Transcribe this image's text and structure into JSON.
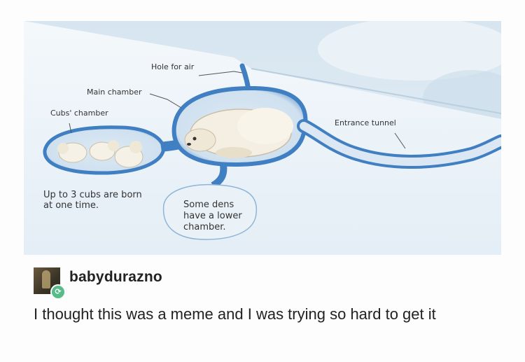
{
  "illustration": {
    "labels": {
      "hole_for_air": "Hole for air",
      "main_chamber": "Main chamber",
      "cubs_chamber": "Cubs' chamber",
      "entrance_tunnel": "Entrance tunnel",
      "cubs_note": "Up to 3 cubs are born at one time.",
      "lower_chamber_note_1": "Some dens",
      "lower_chamber_note_2": "have a lower",
      "lower_chamber_note_3": "chamber."
    },
    "colors": {
      "snow": "#eef4f9",
      "den_outline": "#3f7fc2",
      "sky": "#dfeaf2"
    }
  },
  "post": {
    "username": "babydurazno",
    "avatar_icon": "user-avatar",
    "reblog_icon": "reblog-icon",
    "text": "I thought this was a meme and I was trying so hard to get it"
  }
}
